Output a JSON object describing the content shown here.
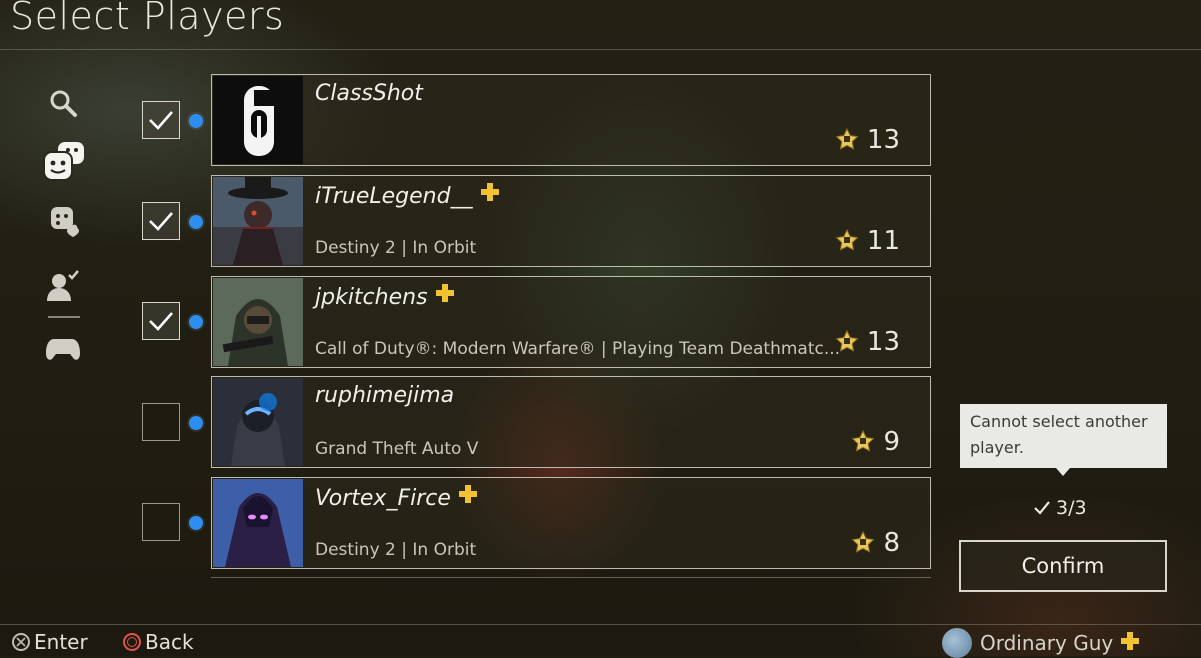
{
  "header": {
    "title": "Select Players"
  },
  "sidebar": {
    "items": [
      {
        "icon": "search-icon"
      },
      {
        "icon": "friends-icon"
      },
      {
        "icon": "favorite-groups-icon"
      },
      {
        "icon": "player-check-icon"
      },
      {
        "icon": "controller-icon"
      }
    ]
  },
  "players": [
    {
      "name": "ClassShot",
      "plus": false,
      "status": "",
      "trophy_level": "13",
      "checked": true
    },
    {
      "name": "iTrueLegend__",
      "plus": true,
      "status": "Destiny 2 | In Orbit",
      "trophy_level": "11",
      "checked": true
    },
    {
      "name": "jpkitchens",
      "plus": true,
      "status": "Call of Duty®: Modern Warfare® | Playing Team Deathmatc...",
      "trophy_level": "13",
      "checked": true
    },
    {
      "name": "ruphimejima",
      "plus": false,
      "status": "Grand Theft Auto V",
      "trophy_level": "9",
      "checked": false
    },
    {
      "name": "Vortex_Firce",
      "plus": true,
      "status": "Destiny 2 | In Orbit",
      "trophy_level": "8",
      "checked": false
    }
  ],
  "tooltip": {
    "text": "Cannot select another player."
  },
  "selection": {
    "count": "3/3"
  },
  "confirm": {
    "label": "Confirm"
  },
  "footer": {
    "enter_label": "Enter",
    "back_label": "Back",
    "username": "Ordinary Guy"
  },
  "colors": {
    "online_dot": "#2d8df0",
    "plus_gold": "#f2c233",
    "tooltip_bg": "#e9e9e5"
  }
}
